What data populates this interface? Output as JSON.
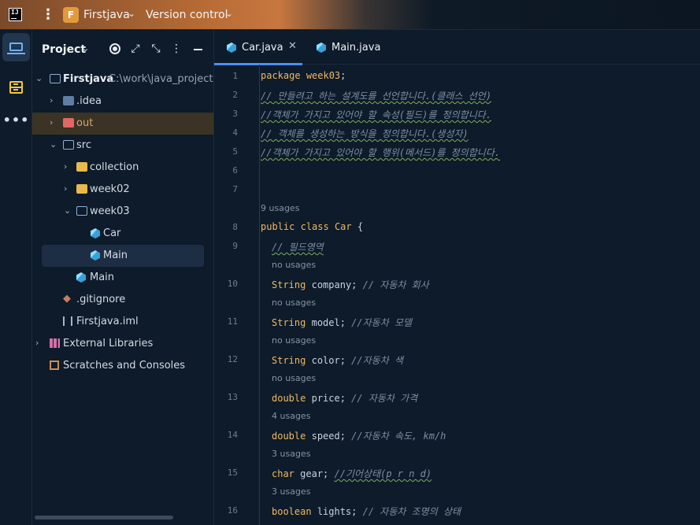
{
  "titlebar": {
    "app_logo": "IJ",
    "project_badge": "F",
    "project_name": "Firstjava",
    "vcs_label": "Version control"
  },
  "project_panel": {
    "title": "Project",
    "tree": [
      {
        "label": "Firstjava",
        "extra": "C:\\work\\java_projects",
        "icon": "folder-icon",
        "expanded": true
      },
      {
        "label": ".idea",
        "icon": "idea-folder-icon",
        "expanded": false
      },
      {
        "label": "out",
        "icon": "excluded-folder-icon",
        "expanded": false
      },
      {
        "label": "src",
        "icon": "source-folder-icon",
        "expanded": true
      },
      {
        "label": "collection",
        "icon": "package-folder-icon",
        "expanded": false
      },
      {
        "label": "week02",
        "icon": "package-folder-icon",
        "expanded": false
      },
      {
        "label": "week03",
        "icon": "package-folder-icon",
        "expanded": true
      },
      {
        "label": "Car",
        "icon": "java-class-icon"
      },
      {
        "label": "Main",
        "icon": "java-class-icon",
        "selected": true
      },
      {
        "label": "Main",
        "icon": "java-class-icon"
      },
      {
        "label": ".gitignore",
        "icon": "git-icon"
      },
      {
        "label": "Firstjava.iml",
        "icon": "iml-icon"
      },
      {
        "label": "External Libraries",
        "icon": "library-icon",
        "expanded": false
      },
      {
        "label": "Scratches and Consoles",
        "icon": "scratches-icon"
      }
    ]
  },
  "editor": {
    "tabs": [
      {
        "label": "Car.java",
        "active": true,
        "closable": true
      },
      {
        "label": "Main.java",
        "active": false
      }
    ],
    "lines": [
      {
        "num": "1",
        "kind": "code"
      },
      {
        "num": "2",
        "text": "// 만들려고 하는 설계도를 선언합니다.(클래스 선언)"
      },
      {
        "num": "3",
        "text": "//객체가 가지고 있어야 할 속성(필드)를 정의합니다."
      },
      {
        "num": "4",
        "text": "// 객체를 생성하는 방식을 정의합니다.(생성자)"
      },
      {
        "num": "5",
        "text": "//객체가 가지고 있어야 할 행위(메서드)를 정의합니다."
      },
      {
        "num": "6"
      },
      {
        "num": "7"
      },
      {
        "num": "8"
      },
      {
        "num": "9",
        "text": "// 필드영역"
      },
      {
        "num": "10",
        "field": "company",
        "type": "String",
        "comment": "// 자동차 회사"
      },
      {
        "num": "11",
        "field": "model",
        "type": "String",
        "comment": "//자동차 모델"
      },
      {
        "num": "12",
        "field": "color",
        "type": "String",
        "comment": "//자동차 색"
      },
      {
        "num": "13",
        "field": "price",
        "type": "double",
        "comment": "// 자동차 가격"
      },
      {
        "num": "14",
        "field": "speed",
        "type": "double",
        "comment": "//자동차 속도, km/h"
      },
      {
        "num": "15",
        "field": "gear",
        "type": "char",
        "comment": "//기어상태(p r n d)"
      },
      {
        "num": "16",
        "field": "lights",
        "type": "boolean",
        "comment": "// 자동차 조명의 상태"
      }
    ],
    "package_kw": "package",
    "package_name": "week03",
    "class_usages": "9 usages",
    "class_decl": {
      "public": "public",
      "class": "class",
      "name": "Car",
      "brace": "{"
    },
    "usages": [
      "no usages",
      "no usages",
      "no usages",
      "no usages",
      "4 usages",
      "3 usages",
      "3 usages"
    ]
  },
  "colors": {
    "accent": "#4b8ef3",
    "keyword": "#f2b760",
    "comment": "#7f8fa3",
    "background": "#0d1b2a"
  }
}
